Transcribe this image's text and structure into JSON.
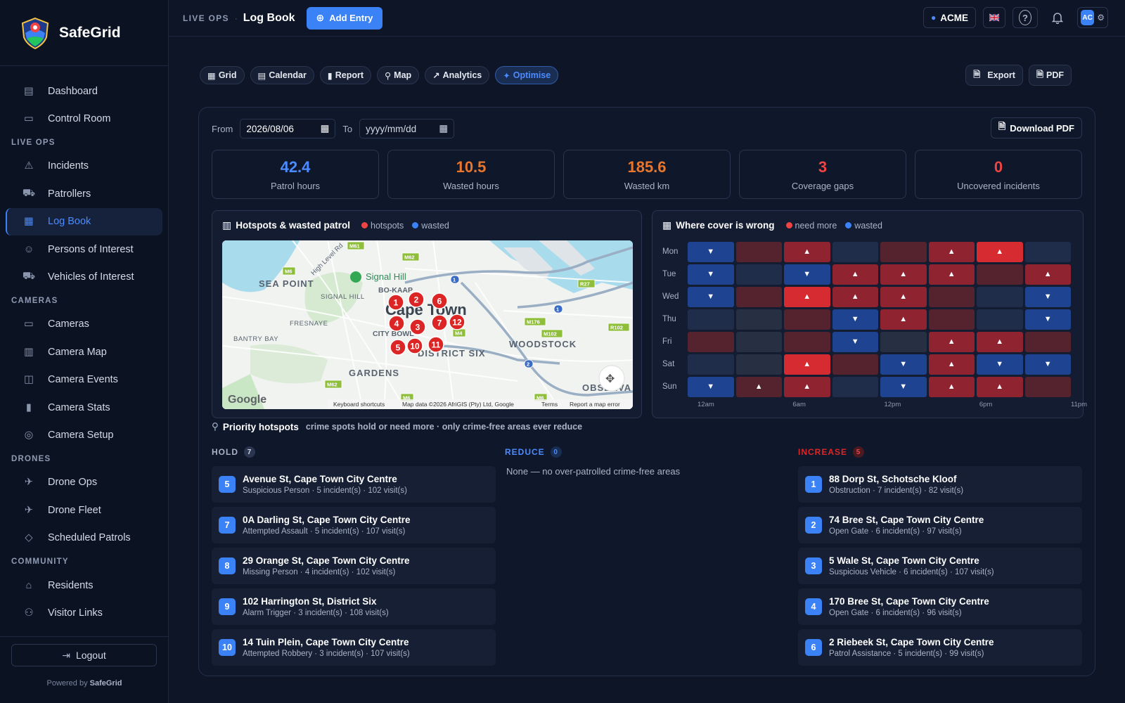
{
  "brand": {
    "name": "SafeGrid"
  },
  "sidebar": {
    "groups": [
      {
        "section": "",
        "items": [
          {
            "label": "Dashboard",
            "icon": "dashboard-icon"
          },
          {
            "label": "Control Room",
            "icon": "monitor-icon"
          }
        ]
      },
      {
        "section": "LIVE OPS",
        "items": [
          {
            "label": "Incidents",
            "icon": "warning-icon"
          },
          {
            "label": "Patrollers",
            "icon": "car-icon"
          },
          {
            "label": "Log Book",
            "icon": "logbook-icon",
            "active": true
          },
          {
            "label": "Persons of Interest",
            "icon": "person-icon"
          },
          {
            "label": "Vehicles of Interest",
            "icon": "vehicle-icon"
          }
        ]
      },
      {
        "section": "CAMERAS",
        "items": [
          {
            "label": "Cameras",
            "icon": "camera-icon"
          },
          {
            "label": "Camera Map",
            "icon": "map-icon"
          },
          {
            "label": "Camera Events",
            "icon": "events-icon"
          },
          {
            "label": "Camera Stats",
            "icon": "stats-icon"
          },
          {
            "label": "Camera Setup",
            "icon": "setup-icon"
          }
        ]
      },
      {
        "section": "DRONES",
        "items": [
          {
            "label": "Drone Ops",
            "icon": "drone-icon"
          },
          {
            "label": "Drone Fleet",
            "icon": "drone-fleet-icon"
          },
          {
            "label": "Scheduled Patrols",
            "icon": "patrol-icon"
          }
        ]
      },
      {
        "section": "COMMUNITY",
        "items": [
          {
            "label": "Residents",
            "icon": "home-icon"
          },
          {
            "label": "Visitor Links",
            "icon": "visitor-icon"
          }
        ]
      }
    ],
    "logout": "Logout",
    "powered_prefix": "Powered by",
    "powered_brand": "SafeGrid"
  },
  "topbar": {
    "crumb": "LIVE OPS",
    "sep": "·",
    "title": "Log Book",
    "add": "Add Entry",
    "org": "ACME",
    "avatar": "AC"
  },
  "views": [
    {
      "label": "Grid",
      "icon": "grid-icon"
    },
    {
      "label": "Calendar",
      "icon": "calendar-icon"
    },
    {
      "label": "Report",
      "icon": "report-icon"
    },
    {
      "label": "Map",
      "icon": "map-pin-icon"
    },
    {
      "label": "Analytics",
      "icon": "analytics-icon"
    },
    {
      "label": "Optimise",
      "icon": "sparkle-icon",
      "active": true
    }
  ],
  "actions": {
    "export": "Export",
    "pdf": "PDF"
  },
  "filters": {
    "from_label": "From",
    "from_value": "2026/08/06",
    "to_label": "To",
    "to_placeholder": "yyyy/mm/dd",
    "download": "Download PDF"
  },
  "kpis": [
    {
      "value": "42.4",
      "label": "Patrol hours",
      "color": "#4b8bff"
    },
    {
      "value": "10.5",
      "label": "Wasted hours",
      "color": "#e8762c"
    },
    {
      "value": "185.6",
      "label": "Wasted km",
      "color": "#e8762c"
    },
    {
      "value": "3",
      "label": "Coverage gaps",
      "color": "#ef4444"
    },
    {
      "value": "0",
      "label": "Uncovered incidents",
      "color": "#ef4444"
    }
  ],
  "hotspot_card": {
    "title": "Hotspots & wasted patrol",
    "legend_hot": "hotspots",
    "legend_wasted": "wasted"
  },
  "map": {
    "labels": [
      "SEA POINT",
      "SIGNAL HILL",
      "Signal Hill",
      "BO-KAAP",
      "Cape Town",
      "FRESNAYE",
      "BANTRY BAY",
      "CITY BOWL",
      "DISTRICT SIX",
      "WOODSTOCK",
      "GARDENS",
      "OBSERVA",
      "High Level Rd"
    ],
    "roads": [
      "M61",
      "M6",
      "M62",
      "M6",
      "M62",
      "M176",
      "M102",
      "M4",
      "R102",
      "R27",
      "1",
      "1",
      "2",
      "M6"
    ],
    "markers": [
      "1",
      "2",
      "6",
      "4",
      "3",
      "7",
      "12",
      "5",
      "10",
      "11"
    ],
    "google": "Google",
    "footer": [
      "Keyboard shortcuts",
      "Map data ©2026 AfriGIS (Pty) Ltd, Google",
      "Terms",
      "Report a map error"
    ]
  },
  "cover_card": {
    "title": "Where cover is wrong",
    "legend_more": "need more",
    "legend_wasted": "wasted"
  },
  "heatmap": {
    "days": [
      "Mon",
      "Tue",
      "Wed",
      "Thu",
      "Fri",
      "Sat",
      "Sun"
    ],
    "x_ticks": [
      "12am",
      "6am",
      "12pm",
      "6pm",
      "11pm"
    ],
    "cells": [
      [
        -3,
        1,
        2,
        -1,
        1,
        2,
        3,
        -1
      ],
      [
        -3,
        -1,
        -3,
        2,
        2,
        2,
        1,
        2
      ],
      [
        -3,
        1,
        3,
        2,
        2,
        1,
        -1,
        -3
      ],
      [
        -1,
        0,
        1,
        -3,
        2,
        1,
        -1,
        -3
      ],
      [
        1,
        0,
        1,
        -3,
        0,
        2,
        2,
        1
      ],
      [
        -1,
        0,
        3,
        1,
        -3,
        2,
        -3,
        -3
      ],
      [
        -3,
        1,
        2,
        -1,
        -3,
        2,
        2,
        1
      ]
    ],
    "arrows": [
      [
        "▼",
        "",
        "▲",
        "",
        "",
        "▲",
        "▲",
        ""
      ],
      [
        "▼",
        "",
        "▼",
        "▲",
        "▲",
        "▲",
        "",
        "▲"
      ],
      [
        "▼",
        "",
        "▲",
        "▲",
        "▲",
        "",
        "",
        "▼"
      ],
      [
        "",
        "",
        "",
        "▼",
        "▲",
        "",
        "",
        "▼"
      ],
      [
        "",
        "",
        "",
        "▼",
        "",
        "▲",
        "▲",
        ""
      ],
      [
        "",
        "",
        "▲",
        "",
        "▼",
        "▲",
        "▼",
        "▼"
      ],
      [
        "▼",
        "▲",
        "▲",
        "",
        "▼",
        "▲",
        "▲",
        ""
      ]
    ]
  },
  "priority": {
    "title": "Priority hotspots",
    "subtitle": "crime spots hold or need more · only crime-free areas ever reduce"
  },
  "hold": {
    "label": "HOLD",
    "count": "7",
    "items": [
      {
        "rank": "5",
        "title": "Avenue St, Cape Town City Centre",
        "sub": "Suspicious Person · 5 incident(s) · 102 visit(s)"
      },
      {
        "rank": "7",
        "title": "0A Darling St, Cape Town City Centre",
        "sub": "Attempted Assault · 5 incident(s) · 107 visit(s)"
      },
      {
        "rank": "8",
        "title": "29 Orange St, Cape Town City Centre",
        "sub": "Missing Person · 4 incident(s) · 102 visit(s)"
      },
      {
        "rank": "9",
        "title": "102 Harrington St, District Six",
        "sub": "Alarm Trigger · 3 incident(s) · 108 visit(s)"
      },
      {
        "rank": "10",
        "title": "14 Tuin Plein, Cape Town City Centre",
        "sub": "Attempted Robbery · 3 incident(s) · 107 visit(s)"
      }
    ]
  },
  "reduce": {
    "label": "REDUCE",
    "count": "0",
    "empty": "None — no over-patrolled crime-free areas"
  },
  "increase": {
    "label": "INCREASE",
    "count": "5",
    "items": [
      {
        "rank": "1",
        "title": "88 Dorp St, Schotsche Kloof",
        "sub": "Obstruction · 7 incident(s) · 82 visit(s)"
      },
      {
        "rank": "2",
        "title": "74 Bree St, Cape Town City Centre",
        "sub": "Open Gate · 6 incident(s) · 97 visit(s)"
      },
      {
        "rank": "3",
        "title": "5 Wale St, Cape Town City Centre",
        "sub": "Suspicious Vehicle · 6 incident(s) · 107 visit(s)"
      },
      {
        "rank": "4",
        "title": "170 Bree St, Cape Town City Centre",
        "sub": "Open Gate · 6 incident(s) · 96 visit(s)"
      },
      {
        "rank": "6",
        "title": "2 Riebeek St, Cape Town City Centre",
        "sub": "Patrol Assistance · 5 incident(s) · 99 visit(s)"
      }
    ]
  },
  "colors": {
    "accent": "#3b82f6",
    "hot": "#ef4444",
    "wasted": "#3b82f6",
    "increase": "#dc2626",
    "reduce": "#3b82f6"
  }
}
